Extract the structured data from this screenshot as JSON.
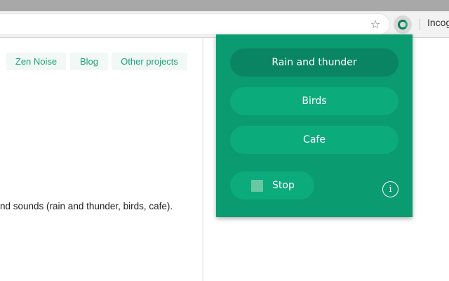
{
  "browser": {
    "bookmark_icon": "star-icon",
    "extension_icon": "zen-noise-extension-icon",
    "profile_label": "Incognito"
  },
  "page": {
    "nav": {
      "zen_noise": "Zen Noise",
      "blog": "Blog",
      "other_projects": "Other projects"
    },
    "body_text": "nd sounds (rain and thunder, birds, cafe)."
  },
  "popup": {
    "sounds": [
      {
        "label": "Rain and thunder",
        "active": true
      },
      {
        "label": "Birds",
        "active": false
      },
      {
        "label": "Cafe",
        "active": false
      }
    ],
    "stop_label": "Stop",
    "info_glyph": "i",
    "colors": {
      "background": "#0a9b70",
      "button": "#0cab7b",
      "active_button": "#0a8563"
    }
  }
}
